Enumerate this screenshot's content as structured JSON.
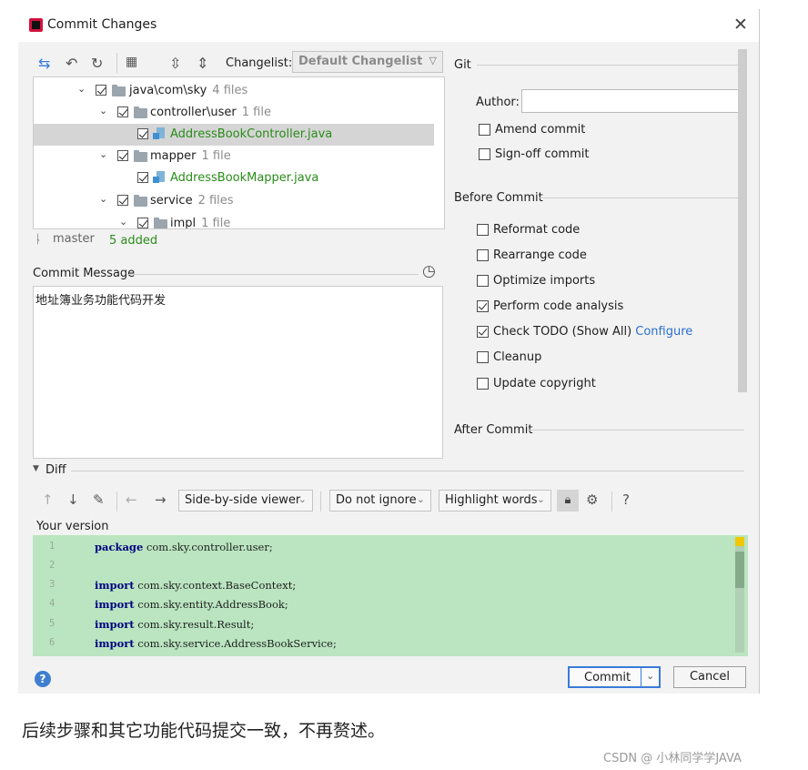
{
  "window": {
    "title": "Commit Changes"
  },
  "toolbar": {
    "changelist_label": "Changelist:",
    "changelist_value": "Default Changelist"
  },
  "tree": {
    "rows": [
      {
        "name": "java\\com\\sky",
        "count": "4 files"
      },
      {
        "name": "controller\\user",
        "count": "1 file"
      },
      {
        "name": "AddressBookController.java",
        "count": ""
      },
      {
        "name": "mapper",
        "count": "1 file"
      },
      {
        "name": "AddressBookMapper.java",
        "count": ""
      },
      {
        "name": "service",
        "count": "2 files"
      },
      {
        "name": "impl",
        "count": "1 file"
      }
    ]
  },
  "status": {
    "branch": "master",
    "added": "5 added"
  },
  "commit_message": {
    "label": "Commit Message",
    "text": "地址簿业务功能代码开发"
  },
  "git": {
    "section": "Git",
    "author_label": "Author:",
    "author_value": "",
    "amend": "Amend commit",
    "signoff": "Sign-off commit"
  },
  "before_commit": {
    "section": "Before Commit",
    "options": [
      {
        "label": "Reformat code",
        "checked": false
      },
      {
        "label": "Rearrange code",
        "checked": false
      },
      {
        "label": "Optimize imports",
        "checked": false
      },
      {
        "label": "Perform code analysis",
        "checked": true
      },
      {
        "label": "Check TODO (Show All)",
        "checked": true,
        "link": "Configure"
      },
      {
        "label": "Cleanup",
        "checked": false
      },
      {
        "label": "Update copyright",
        "checked": false
      }
    ]
  },
  "after_commit": {
    "section": "After Commit"
  },
  "diff": {
    "label": "Diff",
    "viewer": "Side-by-side viewer",
    "ignore": "Do not ignore",
    "highlight": "Highlight words",
    "help": "?",
    "your_version": "Your version",
    "lines": [
      {
        "n": "1",
        "kw": "package",
        "rest": " com.sky.controller.user;"
      },
      {
        "n": "2",
        "kw": "",
        "rest": ""
      },
      {
        "n": "3",
        "kw": "import",
        "rest": " com.sky.context.BaseContext;"
      },
      {
        "n": "4",
        "kw": "import",
        "rest": " com.sky.entity.AddressBook;"
      },
      {
        "n": "5",
        "kw": "import",
        "rest": " com.sky.result.Result;"
      },
      {
        "n": "6",
        "kw": "import",
        "rest": " com.sky.service.AddressBookService;"
      }
    ]
  },
  "buttons": {
    "commit": "Commit",
    "cancel": "Cancel"
  },
  "caption": "后续步骤和其它功能代码提交一致，不再赘述。",
  "watermark": "CSDN @ 小林同学学JAVA",
  "colors": {
    "accent": "#3a7ad8",
    "diff_bg": "#bae5c0",
    "added": "#2a8c1a"
  }
}
